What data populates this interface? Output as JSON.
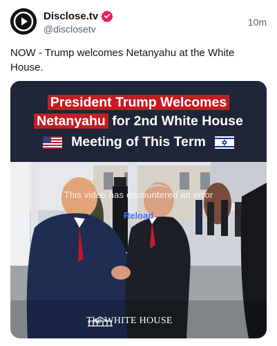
{
  "account": {
    "display_name": "Disclose.tv",
    "handle": "@disclosetv",
    "time": "10m"
  },
  "post": {
    "text": "NOW - Trump welcomes Netanyahu at the White House."
  },
  "media": {
    "banner": {
      "line1_highlight": "President Trump Welcomes",
      "line2_highlight": "Netanyahu",
      "line2_rest": " for 2nd White House",
      "line3": "Meeting of This Term"
    },
    "video_error": "This video has encountered an error",
    "reload_label": "Reload",
    "watermark": "The WHITE HOUSE"
  },
  "colors": {
    "verified_badge": "#e0245e",
    "banner_bg": "#1e2637",
    "banner_highlight": "#c11d22",
    "reload_link": "#4a6cf7"
  }
}
